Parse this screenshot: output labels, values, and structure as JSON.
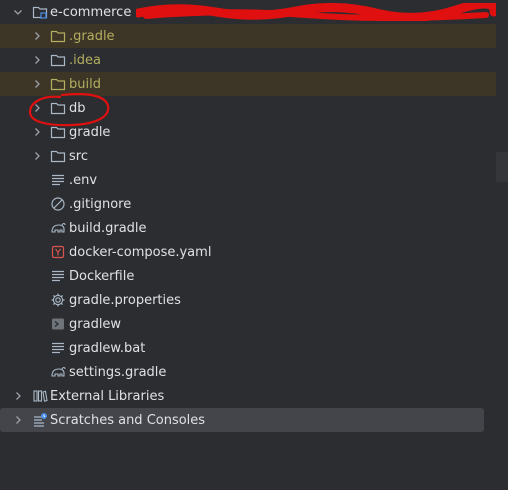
{
  "project_tree": {
    "root": {
      "label": "e-commerce",
      "icon": "project-module-icon",
      "expanded": true
    },
    "children": [
      {
        "label": ".gradle",
        "kind": "folder",
        "style": "excluded"
      },
      {
        "label": ".idea",
        "kind": "folder",
        "style": "olive"
      },
      {
        "label": "build",
        "kind": "folder",
        "style": "excluded"
      },
      {
        "label": "db",
        "kind": "folder",
        "style": "normal",
        "annotated": true
      },
      {
        "label": "gradle",
        "kind": "folder",
        "style": "normal"
      },
      {
        "label": "src",
        "kind": "folder",
        "style": "normal"
      },
      {
        "label": ".env",
        "kind": "text-file",
        "style": "normal"
      },
      {
        "label": ".gitignore",
        "kind": "ignore-file",
        "style": "normal"
      },
      {
        "label": "build.gradle",
        "kind": "gradle-file",
        "style": "normal"
      },
      {
        "label": "docker-compose.yaml",
        "kind": "yaml-file",
        "style": "normal"
      },
      {
        "label": "Dockerfile",
        "kind": "text-file",
        "style": "normal"
      },
      {
        "label": "gradle.properties",
        "kind": "gear-file",
        "style": "normal"
      },
      {
        "label": "gradlew",
        "kind": "shell-file",
        "style": "normal"
      },
      {
        "label": "gradlew.bat",
        "kind": "text-file",
        "style": "normal"
      },
      {
        "label": "settings.gradle",
        "kind": "gradle-file",
        "style": "normal"
      }
    ],
    "external_libraries": {
      "label": "External Libraries",
      "icon": "library-icon"
    },
    "scratches": {
      "label": "Scratches and Consoles",
      "icon": "scratches-icon"
    }
  },
  "colors": {
    "background": "#2b2d30",
    "excluded_row": "#3d3526",
    "olive_text": "#b3ae60",
    "annotation_red": "#e01010",
    "yaml_red": "#d9534f"
  }
}
